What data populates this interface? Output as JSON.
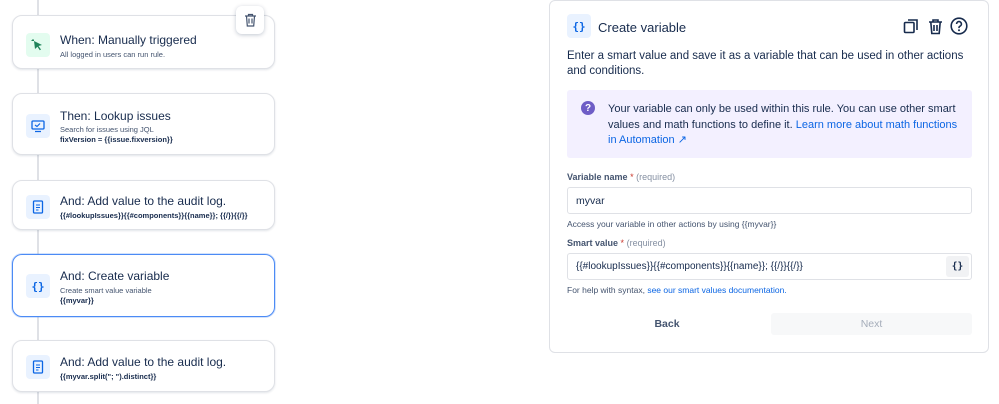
{
  "flow": {
    "cards": [
      {
        "title": "When: Manually triggered",
        "subtitle": "All logged in users can run rule.",
        "icon": "cursor-click-icon"
      },
      {
        "title": "Then: Lookup issues",
        "subtitle": "Search for issues using JQL",
        "code": "fixVersion = {{issue.fixversion}}",
        "icon": "monitor-icon"
      },
      {
        "title": "And: Add value to the audit log.",
        "code": "{{#lookupIssues}}{{#components}}{{name}}; {{/}}{{/}}",
        "icon": "document-icon"
      },
      {
        "title": "And: Create variable",
        "subtitle": "Create smart value variable",
        "code": "{{myvar}}",
        "icon": "braces-icon",
        "glyph": "{}"
      },
      {
        "title": "And: Add value to the audit log.",
        "code": "{{myvar.split(\"; \").distinct}}",
        "icon": "document-icon"
      }
    ]
  },
  "panel": {
    "icon_glyph": "{}",
    "title": "Create variable",
    "description": "Enter a smart value and save it as a variable that can be used in other actions and conditions.",
    "info": {
      "glyph": "?",
      "text": "Your variable can only be used within this rule. You can use other smart values and math functions to define it. ",
      "link": "Learn more about math functions in Automation ↗"
    },
    "variable_name": {
      "label": "Variable name",
      "required_mark": "*",
      "required_text": "(required)",
      "value": "myvar",
      "help": "Access your variable in other actions by using {{myvar}}"
    },
    "smart_value": {
      "label": "Smart value",
      "required_mark": "*",
      "required_text": "(required)",
      "value": "{{#lookupIssues}}{{#components}}{{name}}; {{/}}{{/}}",
      "button_glyph": "{}",
      "help_prefix": "For help with syntax, ",
      "help_link": "see our smart values documentation."
    },
    "back_label": "Back",
    "next_label": "Next"
  },
  "colors": {
    "accent": "#0c66e4",
    "selected_border": "#4c8bf5",
    "info_bg": "#f3f0ff",
    "trigger_icon": "#1f845a"
  }
}
